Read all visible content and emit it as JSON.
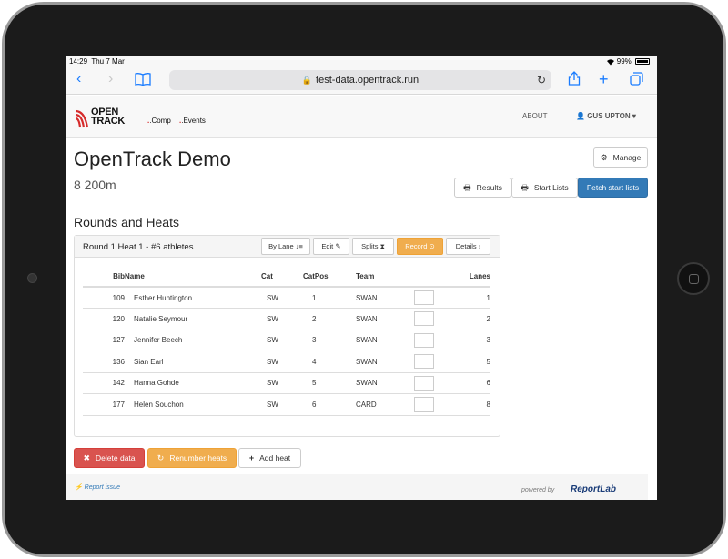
{
  "status": {
    "time": "14:29",
    "date": "Thu 7 Mar",
    "battery": "99%"
  },
  "browser": {
    "url": "test-data.opentrack.run"
  },
  "site": {
    "logo_line1": "OPEN",
    "logo_line2": "TRACK",
    "nav_links": [
      ".Comp",
      ".Events"
    ],
    "about": "ABOUT",
    "user": "GUS UPTON"
  },
  "page": {
    "title": "OpenTrack Demo",
    "subtitle": "8 200m",
    "manage_label": "Manage",
    "results_label": "Results",
    "start_lists_label": "Start Lists",
    "fetch_label": "Fetch start lists"
  },
  "rounds": {
    "section_title": "Rounds and Heats",
    "panel_title": "Round 1 Heat 1 - #6 athletes",
    "buttons": {
      "by_lane": "By Lane",
      "edit": "Edit",
      "splits": "Splits",
      "record": "Record",
      "details": "Details"
    },
    "columns": [
      "Bib",
      "Name",
      "Cat",
      "CatPos",
      "Team",
      "Lanes"
    ],
    "rows": [
      {
        "bib": "109",
        "name": "Esther Huntington",
        "cat": "SW",
        "catpos": "1",
        "team": "SWAN",
        "lane": "1"
      },
      {
        "bib": "120",
        "name": "Natalie Seymour",
        "cat": "SW",
        "catpos": "2",
        "team": "SWAN",
        "lane": "2"
      },
      {
        "bib": "127",
        "name": "Jennifer Beech",
        "cat": "SW",
        "catpos": "3",
        "team": "SWAN",
        "lane": "3"
      },
      {
        "bib": "136",
        "name": "Sian Earl",
        "cat": "SW",
        "catpos": "4",
        "team": "SWAN",
        "lane": "5"
      },
      {
        "bib": "142",
        "name": "Hanna Gohde",
        "cat": "SW",
        "catpos": "5",
        "team": "SWAN",
        "lane": "6"
      },
      {
        "bib": "177",
        "name": "Helen Souchon",
        "cat": "SW",
        "catpos": "6",
        "team": "CARD",
        "lane": "8"
      }
    ]
  },
  "actions": {
    "delete": "Delete data",
    "renumber": "Renumber heats",
    "add_heat": "Add heat"
  },
  "footer": {
    "report": "Report issue",
    "powered": "powered by",
    "brand": "ReportLab"
  },
  "colors": {
    "primary": "#337ab7",
    "warning": "#f0ad4e",
    "danger": "#d9534f",
    "logo_red": "#d62b2b"
  }
}
